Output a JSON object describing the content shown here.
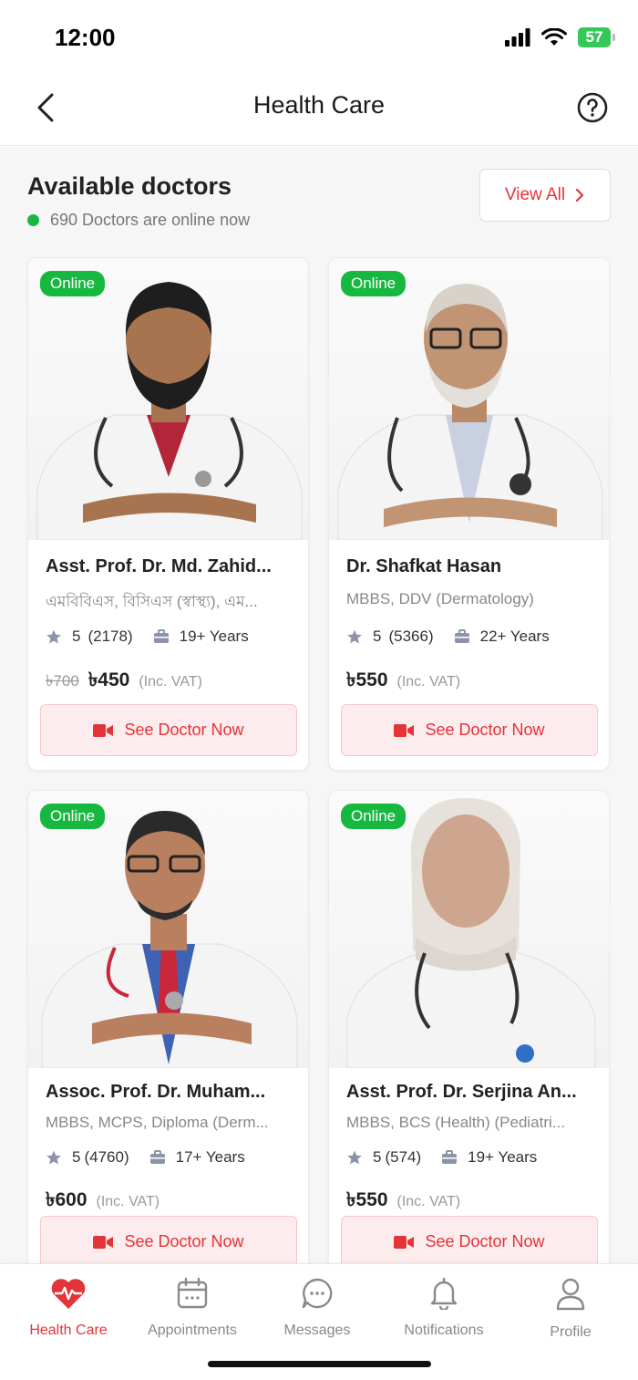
{
  "status_bar": {
    "time": "12:00",
    "battery": "57"
  },
  "header": {
    "title": "Health Care"
  },
  "section": {
    "title": "Available doctors",
    "online_text": "690 Doctors are online now",
    "view_all_label": "View All"
  },
  "doctors": [
    {
      "badge": "Online",
      "name": "Asst. Prof. Dr. Md. Zahid...",
      "degree": "এমবিবিএস, বিসিএস (স্বাস্থ্য), এম...",
      "rating": "5",
      "reviews": "(2178)",
      "experience": "19+ Years",
      "old_price": "৳700",
      "price": "৳450",
      "vat": "(Inc. VAT)",
      "button": "See Doctor Now"
    },
    {
      "badge": "Online",
      "name": "Dr. Shafkat Hasan",
      "degree": "MBBS, DDV (Dermatology)",
      "rating": "5",
      "reviews": "(5366)",
      "experience": "22+ Years",
      "old_price": "",
      "price": "৳550",
      "vat": "(Inc. VAT)",
      "button": "See Doctor Now"
    },
    {
      "badge": "Online",
      "name": "Assoc. Prof. Dr. Muham...",
      "degree": "MBBS, MCPS, Diploma (Derm...",
      "rating": "5",
      "reviews": "(4760)",
      "experience": "17+ Years",
      "old_price": "",
      "price": "৳600",
      "vat": "(Inc. VAT)",
      "button": "See Doctor Now"
    },
    {
      "badge": "Online",
      "name": "Asst. Prof. Dr. Serjina An...",
      "degree": "MBBS, BCS (Health) (Pediatri...",
      "rating": "5",
      "reviews": "(574)",
      "experience": "19+ Years",
      "old_price": "",
      "price": "৳550",
      "vat": "(Inc. VAT)",
      "button": "See Doctor Now"
    }
  ],
  "bottom_nav": [
    {
      "label": "Health Care",
      "icon": "heart-pulse-icon",
      "active": true
    },
    {
      "label": "Appointments",
      "icon": "calendar-icon",
      "active": false
    },
    {
      "label": "Messages",
      "icon": "chat-icon",
      "active": false
    },
    {
      "label": "Notifications",
      "icon": "bell-icon",
      "active": false
    },
    {
      "label": "Profile",
      "icon": "user-icon",
      "active": false
    }
  ],
  "colors": {
    "accent": "#e3343a",
    "online": "#16b83f"
  }
}
